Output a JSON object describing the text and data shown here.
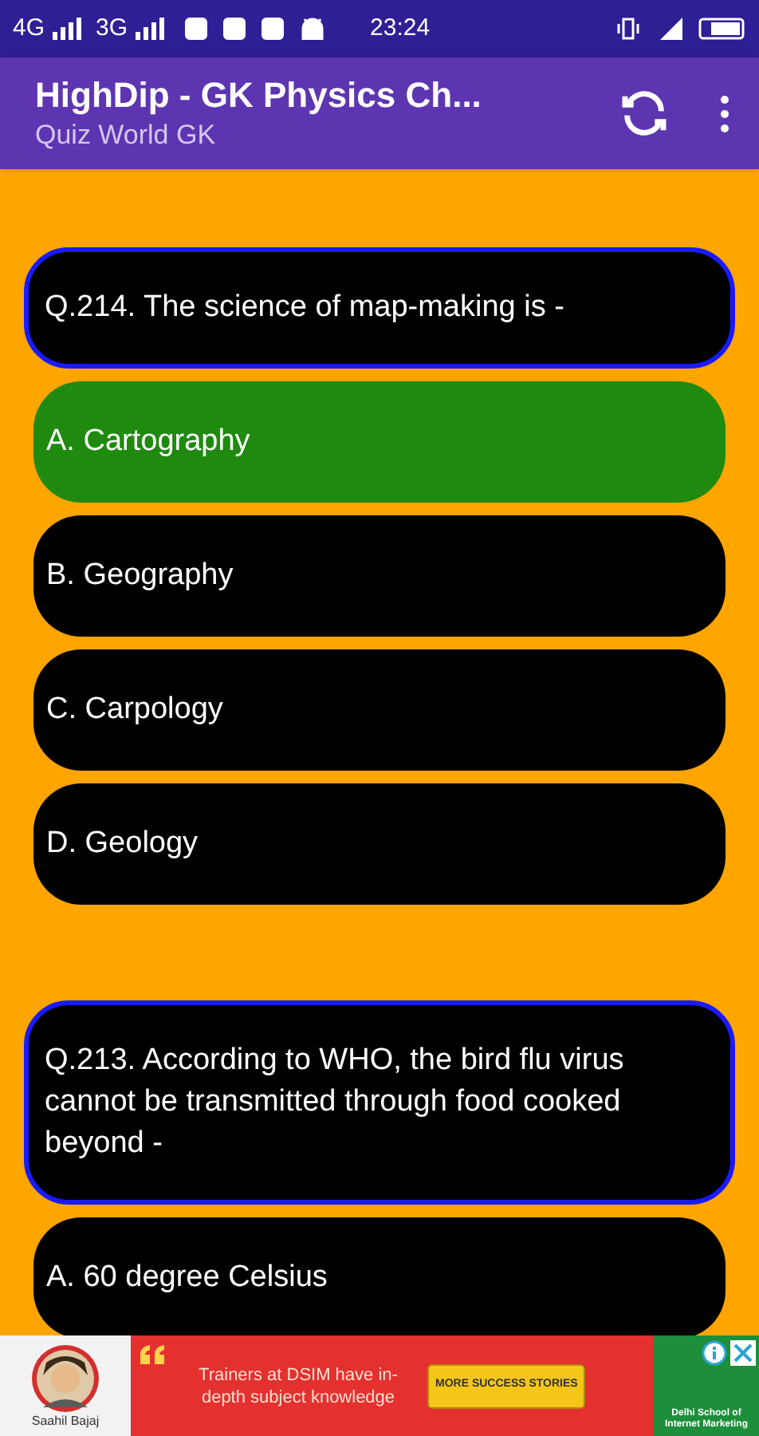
{
  "status_bar": {
    "network_1": "4G",
    "network_2": "3G",
    "time": "23:24"
  },
  "app_bar": {
    "title": "HighDip - GK Physics Ch...",
    "subtitle": "Quiz World GK"
  },
  "questions": [
    {
      "text": "Q.214. The science of map-making is -",
      "options": [
        {
          "label": "A. Cartography",
          "correct": true
        },
        {
          "label": "B. Geography",
          "correct": false
        },
        {
          "label": "C. Carpology",
          "correct": false
        },
        {
          "label": "D. Geology",
          "correct": false
        }
      ]
    },
    {
      "text": "Q.213. According to WHO, the bird flu virus cannot be transmitted through food cooked beyond -",
      "options": [
        {
          "label": "A. 60 degree Celsius",
          "correct": false
        }
      ]
    }
  ],
  "ad": {
    "person_name": "Saahil Bajaj",
    "message": "Trainers at DSIM have in-depth subject knowledge",
    "button": "MORE SUCCESS STORIES",
    "brand": "Delhi School of Internet Marketing"
  }
}
